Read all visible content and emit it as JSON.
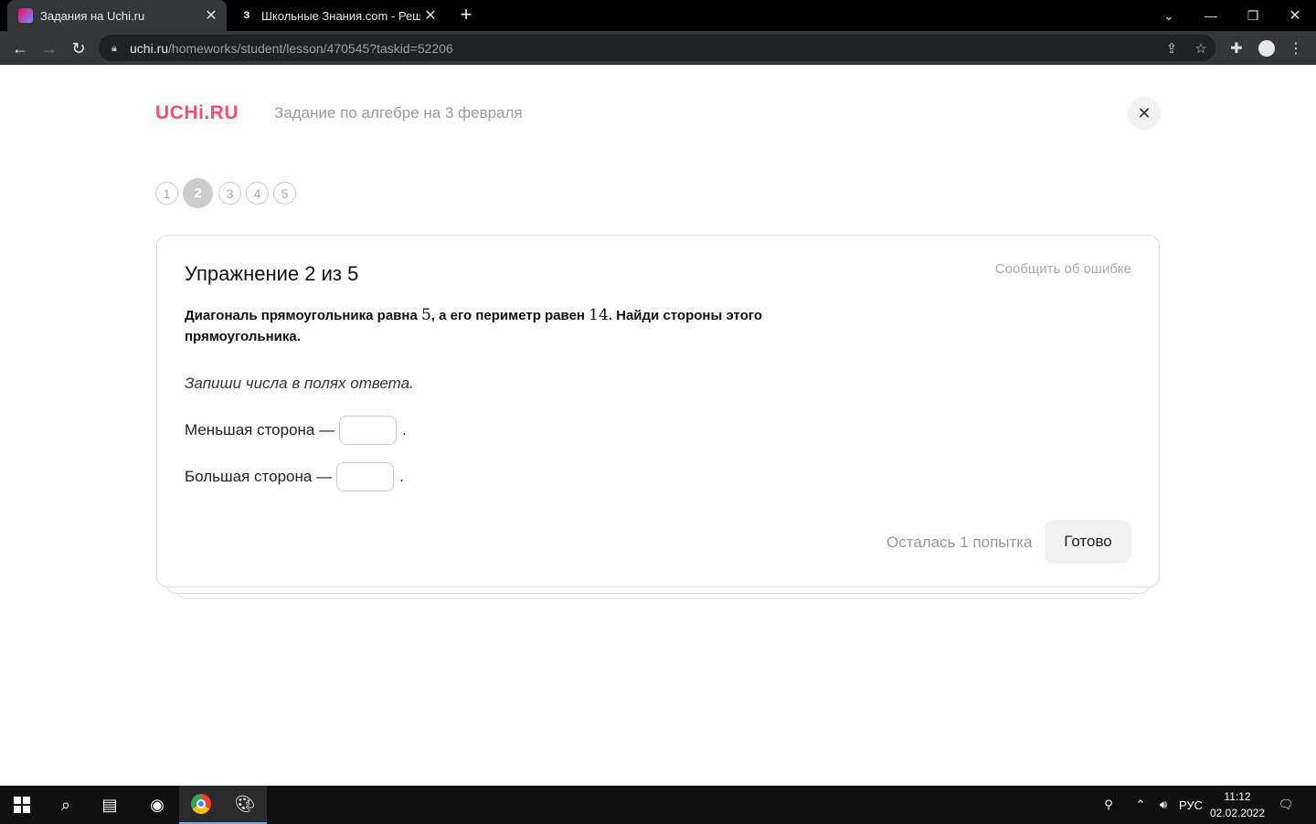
{
  "browser": {
    "tabs": [
      {
        "title": "Задания на Uchi.ru",
        "active": true
      },
      {
        "title": "Школьные Знания.com - Решае",
        "active": false,
        "favicon_letter": "З"
      }
    ],
    "url_host": "uchi.ru",
    "url_path": "/homeworks/student/lesson/470545?taskid=52206"
  },
  "header": {
    "logo": "UCHi.RU",
    "title": "Задание по алгебре на 3 февраля"
  },
  "steps": [
    "1",
    "2",
    "3",
    "4",
    "5"
  ],
  "current_step": 2,
  "exercise": {
    "title": "Упражнение 2 из 5",
    "report_link": "Сообщить об ошибке",
    "question_part1": "Диагональ прямоугольника равна ",
    "question_num1": "5",
    "question_part2": ", а его периметр равен ",
    "question_num2": "14",
    "question_part3": ". Найди стороны этого прямоугольника.",
    "instruction": "Запиши числа в полях ответа.",
    "answers": [
      {
        "label": "Меньшая сторона —",
        "value": "",
        "suffix": "."
      },
      {
        "label": "Большая сторона —",
        "value": "",
        "suffix": "."
      }
    ],
    "attempts": "Осталась 1 попытка",
    "done_button": "Готово"
  },
  "taskbar": {
    "language": "РУС",
    "time": "11:12",
    "date": "02.02.2022"
  }
}
